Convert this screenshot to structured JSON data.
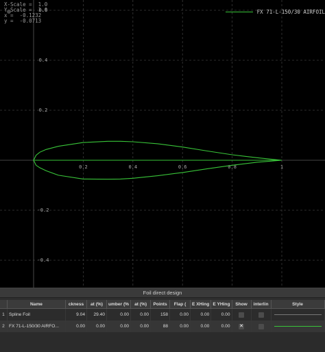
{
  "readout": {
    "x_scale": "X-Scale =  1.0",
    "y_scale": "Y-Scale =  1.0",
    "x": "x =  -0.1232",
    "y": "y =  -0.0713"
  },
  "legend": {
    "label": "FX 71-L-150/30 AIRFOIL",
    "color": "#39c639"
  },
  "axes": {
    "x_ticks": [
      "0.2",
      "0.4",
      "0.6",
      "0.8",
      "1"
    ],
    "y_ticks": [
      "0.6",
      "0.4",
      "0.2",
      "-0.2",
      "-0.4"
    ]
  },
  "panel": {
    "title": "Foil direct design",
    "columns": [
      "",
      "Name",
      "ckness",
      "at (%)",
      "umber (%",
      "at (%)",
      "Points",
      "Flap (",
      "E XHing",
      "E YHing",
      "Show",
      "interlin",
      "Style"
    ],
    "rows": [
      {
        "idx": "1",
        "name": "Spline Foil",
        "thickness": "9.04",
        "at1": "29.40",
        "camber": "0.00",
        "at2": "0.00",
        "points": "158",
        "flap": "0.00",
        "xhinge": "0.00",
        "yhinge": "0.00",
        "show": "",
        "style": "gray"
      },
      {
        "idx": "2",
        "name": "FX 71-L-150/30 AIRFO...",
        "thickness": "0.00",
        "at1": "0.00",
        "camber": "0.00",
        "at2": "0.00",
        "points": "88",
        "flap": "0.00",
        "xhinge": "0.00",
        "yhinge": "0.00",
        "show": "✕",
        "style": "green"
      }
    ]
  },
  "chart_data": {
    "type": "line",
    "x_range": [
      -0.12,
      1.17
    ],
    "y_range": [
      -0.52,
      0.64
    ],
    "grid": true,
    "legend_position": "top-right",
    "series": [
      {
        "name": "FX 71-L-150/30 AIRFOIL",
        "color": "#39c639",
        "upper": [
          [
            1,
            0
          ],
          [
            0.95,
            0.005
          ],
          [
            0.9,
            0.01
          ],
          [
            0.85,
            0.016
          ],
          [
            0.8,
            0.022
          ],
          [
            0.7,
            0.037
          ],
          [
            0.6,
            0.053
          ],
          [
            0.5,
            0.066
          ],
          [
            0.4,
            0.074
          ],
          [
            0.35,
            0.076
          ],
          [
            0.3,
            0.076
          ],
          [
            0.2,
            0.071
          ],
          [
            0.1,
            0.056
          ],
          [
            0.05,
            0.043
          ],
          [
            0.025,
            0.032
          ],
          [
            0.01,
            0.02
          ],
          [
            0,
            0
          ]
        ],
        "lower": [
          [
            0,
            0
          ],
          [
            0.01,
            -0.02
          ],
          [
            0.025,
            -0.03
          ],
          [
            0.05,
            -0.042
          ],
          [
            0.1,
            -0.06
          ],
          [
            0.2,
            -0.075
          ],
          [
            0.3,
            -0.076
          ],
          [
            0.35,
            -0.075
          ],
          [
            0.4,
            -0.072
          ],
          [
            0.5,
            -0.062
          ],
          [
            0.6,
            -0.049
          ],
          [
            0.7,
            -0.034
          ],
          [
            0.8,
            -0.02
          ],
          [
            0.9,
            -0.008
          ],
          [
            1,
            0
          ]
        ],
        "camber_line": [
          [
            0,
            0
          ],
          [
            1,
            0
          ]
        ]
      }
    ]
  }
}
